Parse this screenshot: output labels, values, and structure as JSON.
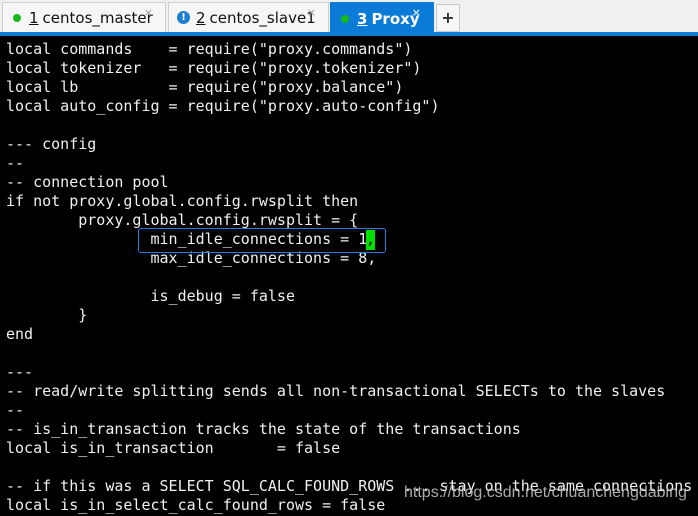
{
  "tabs": [
    {
      "number": "1",
      "label": "centos_master",
      "status": "connected",
      "close": "×"
    },
    {
      "number": "2",
      "label": "centos_slave1",
      "status": "warning",
      "close": "×"
    },
    {
      "number": "3",
      "label": "Proxy",
      "status": "connected",
      "active": true,
      "close": "×"
    }
  ],
  "add_tab_label": "+",
  "warning_glyph": "!",
  "colors": {
    "accent": "#0a7bd6",
    "connected": "#17b817",
    "cursor": "#00e000",
    "selection_box": "#2a7de1"
  },
  "terminal": {
    "lines": [
      "local commands    = require(\"proxy.commands\")",
      "local tokenizer   = require(\"proxy.tokenizer\")",
      "local lb          = require(\"proxy.balance\")",
      "local auto_config = require(\"proxy.auto-config\")",
      "",
      "--- config",
      "--",
      "-- connection pool",
      "if not proxy.global.config.rwsplit then",
      "        proxy.global.config.rwsplit = {",
      "                min_idle_connections = 1",
      "                max_idle_connections = 8,",
      "",
      "                is_debug = false",
      "        }",
      "end",
      "",
      "---",
      "-- read/write splitting sends all non-transactional SELECTs to the slaves",
      "--",
      "-- is_in_transaction tracks the state of the transactions",
      "local is_in_transaction       = false",
      "",
      "-- if this was a SELECT SQL_CALC_FOUND_ROWS ... stay on the same connections",
      "local is_in_select_calc_found_rows = false"
    ],
    "cursor_char": ","
  },
  "watermark": "https://blog.csdn.net/chuanchengdabing"
}
